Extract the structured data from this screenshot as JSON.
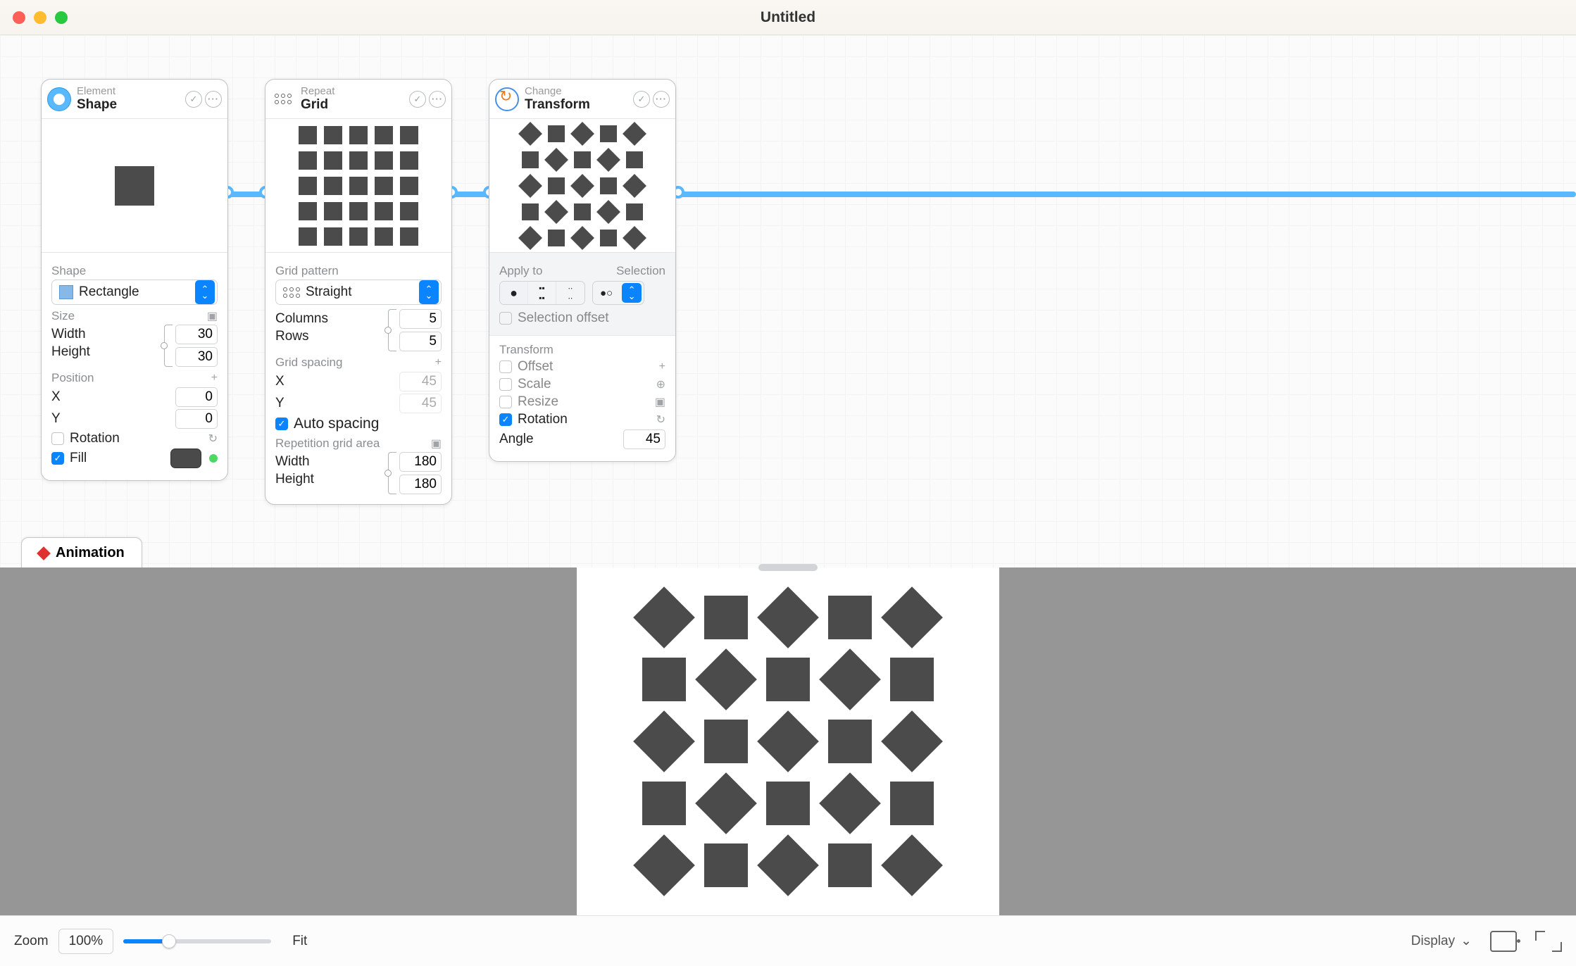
{
  "window": {
    "title": "Untitled"
  },
  "nodes": {
    "shape": {
      "subtitle": "Element",
      "title": "Shape",
      "shape_label": "Shape",
      "shape_value": "Rectangle",
      "size_label": "Size",
      "width_label": "Width",
      "width_value": "30",
      "height_label": "Height",
      "height_value": "30",
      "position_label": "Position",
      "x_label": "X",
      "x_value": "0",
      "y_label": "Y",
      "y_value": "0",
      "rotation_label": "Rotation",
      "fill_label": "Fill"
    },
    "grid": {
      "subtitle": "Repeat",
      "title": "Grid",
      "pattern_label": "Grid pattern",
      "pattern_value": "Straight",
      "columns_label": "Columns",
      "columns_value": "5",
      "rows_label": "Rows",
      "rows_value": "5",
      "spacing_label": "Grid spacing",
      "spacing_x_label": "X",
      "spacing_x_value": "45",
      "spacing_y_label": "Y",
      "spacing_y_value": "45",
      "auto_spacing_label": "Auto spacing",
      "area_label": "Repetition grid area",
      "area_width_label": "Width",
      "area_width_value": "180",
      "area_height_label": "Height",
      "area_height_value": "180"
    },
    "transform": {
      "subtitle": "Change",
      "title": "Transform",
      "apply_to_label": "Apply to",
      "selection_label": "Selection",
      "selection_offset_label": "Selection offset",
      "transform_label": "Transform",
      "offset_label": "Offset",
      "scale_label": "Scale",
      "resize_label": "Resize",
      "rotation_label": "Rotation",
      "angle_label": "Angle",
      "angle_value": "45"
    }
  },
  "animation_tab": "Animation",
  "footer": {
    "zoom_label": "Zoom",
    "zoom_value": "100%",
    "fit_label": "Fit",
    "display_label": "Display"
  }
}
